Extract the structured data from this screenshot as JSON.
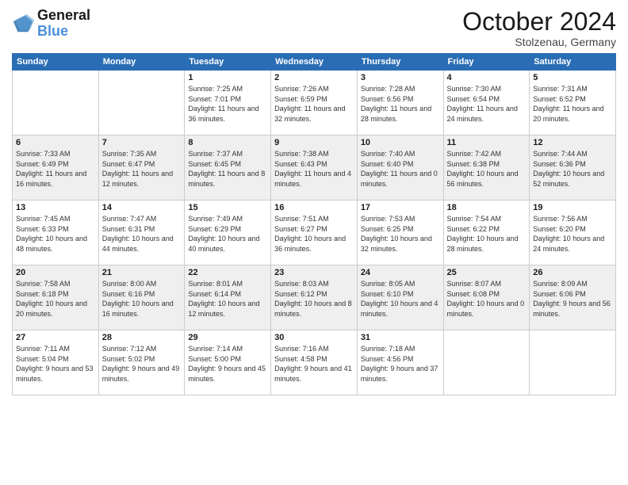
{
  "header": {
    "logo_line1": "General",
    "logo_line2": "Blue",
    "month": "October 2024",
    "location": "Stolzenau, Germany"
  },
  "days_of_week": [
    "Sunday",
    "Monday",
    "Tuesday",
    "Wednesday",
    "Thursday",
    "Friday",
    "Saturday"
  ],
  "weeks": [
    [
      {
        "day": "",
        "info": ""
      },
      {
        "day": "",
        "info": ""
      },
      {
        "day": "1",
        "info": "Sunrise: 7:25 AM\nSunset: 7:01 PM\nDaylight: 11 hours\nand 36 minutes."
      },
      {
        "day": "2",
        "info": "Sunrise: 7:26 AM\nSunset: 6:59 PM\nDaylight: 11 hours\nand 32 minutes."
      },
      {
        "day": "3",
        "info": "Sunrise: 7:28 AM\nSunset: 6:56 PM\nDaylight: 11 hours\nand 28 minutes."
      },
      {
        "day": "4",
        "info": "Sunrise: 7:30 AM\nSunset: 6:54 PM\nDaylight: 11 hours\nand 24 minutes."
      },
      {
        "day": "5",
        "info": "Sunrise: 7:31 AM\nSunset: 6:52 PM\nDaylight: 11 hours\nand 20 minutes."
      }
    ],
    [
      {
        "day": "6",
        "info": "Sunrise: 7:33 AM\nSunset: 6:49 PM\nDaylight: 11 hours\nand 16 minutes."
      },
      {
        "day": "7",
        "info": "Sunrise: 7:35 AM\nSunset: 6:47 PM\nDaylight: 11 hours\nand 12 minutes."
      },
      {
        "day": "8",
        "info": "Sunrise: 7:37 AM\nSunset: 6:45 PM\nDaylight: 11 hours\nand 8 minutes."
      },
      {
        "day": "9",
        "info": "Sunrise: 7:38 AM\nSunset: 6:43 PM\nDaylight: 11 hours\nand 4 minutes."
      },
      {
        "day": "10",
        "info": "Sunrise: 7:40 AM\nSunset: 6:40 PM\nDaylight: 11 hours\nand 0 minutes."
      },
      {
        "day": "11",
        "info": "Sunrise: 7:42 AM\nSunset: 6:38 PM\nDaylight: 10 hours\nand 56 minutes."
      },
      {
        "day": "12",
        "info": "Sunrise: 7:44 AM\nSunset: 6:36 PM\nDaylight: 10 hours\nand 52 minutes."
      }
    ],
    [
      {
        "day": "13",
        "info": "Sunrise: 7:45 AM\nSunset: 6:33 PM\nDaylight: 10 hours\nand 48 minutes."
      },
      {
        "day": "14",
        "info": "Sunrise: 7:47 AM\nSunset: 6:31 PM\nDaylight: 10 hours\nand 44 minutes."
      },
      {
        "day": "15",
        "info": "Sunrise: 7:49 AM\nSunset: 6:29 PM\nDaylight: 10 hours\nand 40 minutes."
      },
      {
        "day": "16",
        "info": "Sunrise: 7:51 AM\nSunset: 6:27 PM\nDaylight: 10 hours\nand 36 minutes."
      },
      {
        "day": "17",
        "info": "Sunrise: 7:53 AM\nSunset: 6:25 PM\nDaylight: 10 hours\nand 32 minutes."
      },
      {
        "day": "18",
        "info": "Sunrise: 7:54 AM\nSunset: 6:22 PM\nDaylight: 10 hours\nand 28 minutes."
      },
      {
        "day": "19",
        "info": "Sunrise: 7:56 AM\nSunset: 6:20 PM\nDaylight: 10 hours\nand 24 minutes."
      }
    ],
    [
      {
        "day": "20",
        "info": "Sunrise: 7:58 AM\nSunset: 6:18 PM\nDaylight: 10 hours\nand 20 minutes."
      },
      {
        "day": "21",
        "info": "Sunrise: 8:00 AM\nSunset: 6:16 PM\nDaylight: 10 hours\nand 16 minutes."
      },
      {
        "day": "22",
        "info": "Sunrise: 8:01 AM\nSunset: 6:14 PM\nDaylight: 10 hours\nand 12 minutes."
      },
      {
        "day": "23",
        "info": "Sunrise: 8:03 AM\nSunset: 6:12 PM\nDaylight: 10 hours\nand 8 minutes."
      },
      {
        "day": "24",
        "info": "Sunrise: 8:05 AM\nSunset: 6:10 PM\nDaylight: 10 hours\nand 4 minutes."
      },
      {
        "day": "25",
        "info": "Sunrise: 8:07 AM\nSunset: 6:08 PM\nDaylight: 10 hours\nand 0 minutes."
      },
      {
        "day": "26",
        "info": "Sunrise: 8:09 AM\nSunset: 6:06 PM\nDaylight: 9 hours\nand 56 minutes."
      }
    ],
    [
      {
        "day": "27",
        "info": "Sunrise: 7:11 AM\nSunset: 5:04 PM\nDaylight: 9 hours\nand 53 minutes."
      },
      {
        "day": "28",
        "info": "Sunrise: 7:12 AM\nSunset: 5:02 PM\nDaylight: 9 hours\nand 49 minutes."
      },
      {
        "day": "29",
        "info": "Sunrise: 7:14 AM\nSunset: 5:00 PM\nDaylight: 9 hours\nand 45 minutes."
      },
      {
        "day": "30",
        "info": "Sunrise: 7:16 AM\nSunset: 4:58 PM\nDaylight: 9 hours\nand 41 minutes."
      },
      {
        "day": "31",
        "info": "Sunrise: 7:18 AM\nSunset: 4:56 PM\nDaylight: 9 hours\nand 37 minutes."
      },
      {
        "day": "",
        "info": ""
      },
      {
        "day": "",
        "info": ""
      }
    ]
  ]
}
